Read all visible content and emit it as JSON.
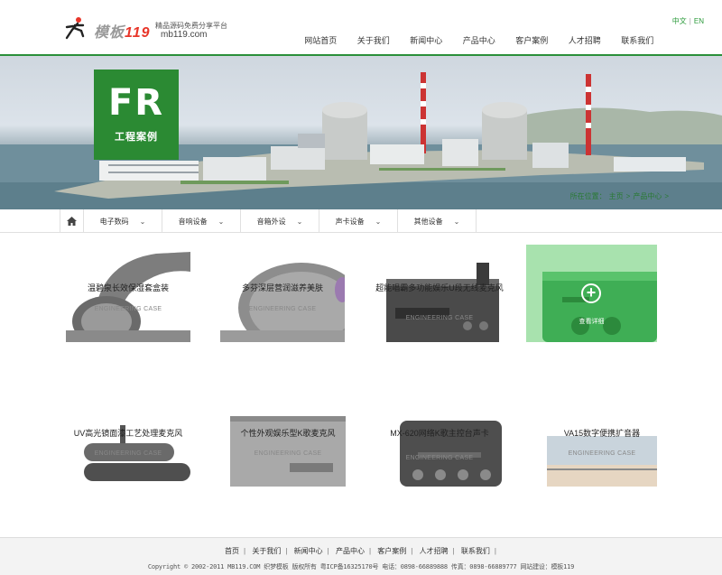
{
  "header": {
    "brand": "模板",
    "brand_number": "119",
    "slogan": "精品源码免费分享平台",
    "domain": "mb119.com",
    "lang": {
      "cn": "中文",
      "en": "EN"
    },
    "nav": [
      "网站首页",
      "关于我们",
      "新闻中心",
      "产品中心",
      "客户案例",
      "人才招聘",
      "联系我们"
    ]
  },
  "banner": {
    "badge_text": "FR",
    "badge_sub": "工程案例",
    "breadcrumb": [
      "所在位置：",
      "主页",
      ">",
      "产品中心",
      ">"
    ]
  },
  "subnav": {
    "home_icon": "home-icon",
    "categories": [
      "电子数码",
      "音响设备",
      "音箱外设",
      "声卡设备",
      "其他设备"
    ]
  },
  "products": [
    {
      "title": "温碧泉长效保湿套盒装",
      "tag": "ENGINEERING CASE"
    },
    {
      "title": "多芬深层营润滋养美肤",
      "tag": "ENGINEERING CASE"
    },
    {
      "title": "超能唱霸多功能娱乐U段无线麦克风",
      "tag": "ENGINEERING CASE"
    },
    {
      "title": "",
      "tag": "",
      "active_label": "查看详细"
    },
    {
      "title": "UV高光镜面漆工艺处理麦克风",
      "tag": "ENGINEERING CASE"
    },
    {
      "title": "个性外观娱乐型K歌麦克风",
      "tag": "ENGINEERING CASE"
    },
    {
      "title": "MX-620网络K歌主控台声卡",
      "tag": "ENGINEERING CASE"
    },
    {
      "title": "VA15数字便携扩音器",
      "tag": "ENGINEERING CASE"
    }
  ],
  "footer": {
    "links": [
      "首页",
      "关于我们",
      "新闻中心",
      "产品中心",
      "客户案例",
      "人才招聘",
      "联系我们"
    ],
    "copyright": "Copyright © 2002-2011 MB119.COM 织梦模板 版权所有    粤ICP备16325170号    电话：0898-66889888 传真：0898-66889777    网站建设：模板119"
  },
  "colors": {
    "accent": "#2b8a33",
    "header_line": "#2a8f3a",
    "active_card": "#56c76a"
  }
}
